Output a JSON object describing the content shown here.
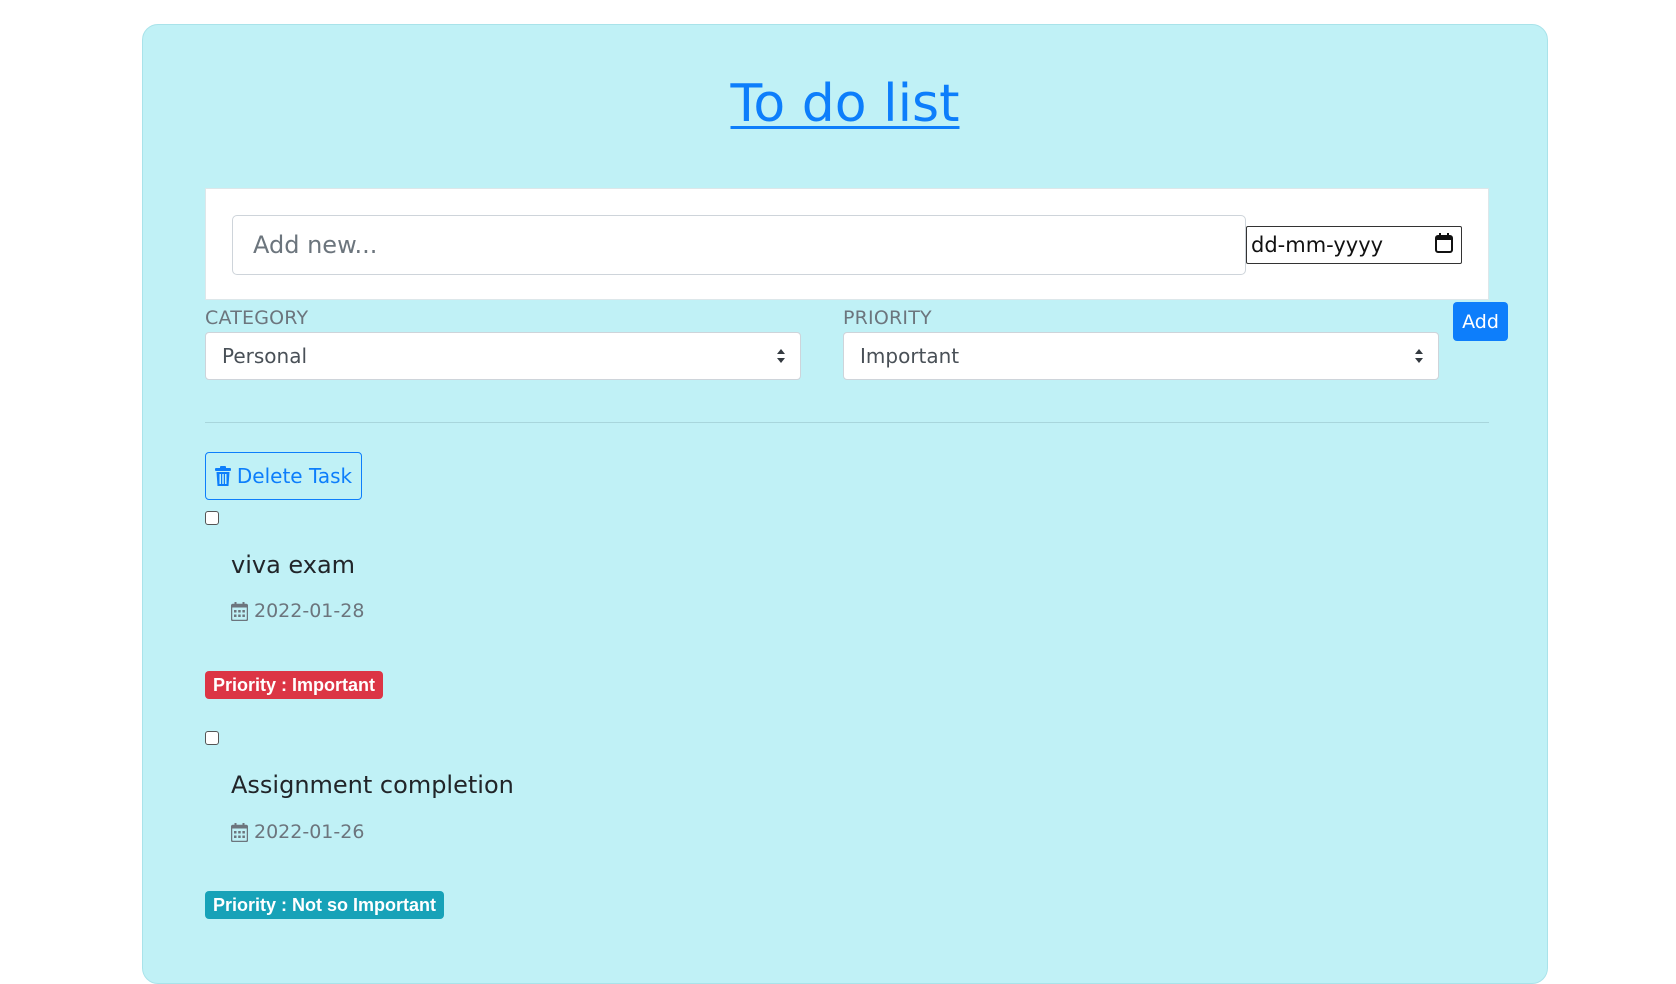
{
  "title": "To do list",
  "new_task": {
    "placeholder": "Add new...",
    "date_placeholder": "dd-mm-yyyy"
  },
  "category": {
    "label": "CATEGORY",
    "selected": "Personal"
  },
  "priority": {
    "label": "PRIORITY",
    "selected": "Important"
  },
  "add_label": "Add",
  "delete_label": "Delete Task",
  "tasks": [
    {
      "title": "viva exam",
      "date": "2022-01-28",
      "priority": "Priority : Important",
      "checked": false,
      "badge_color": "#dc3545"
    },
    {
      "title": "Assignment completion",
      "date": "2022-01-26",
      "priority": "Priority : Not so Important",
      "checked": false,
      "badge_color": "#17a2b8"
    }
  ],
  "colors": {
    "accent": "#0d7efb",
    "card_background": "#c0f1f6"
  }
}
